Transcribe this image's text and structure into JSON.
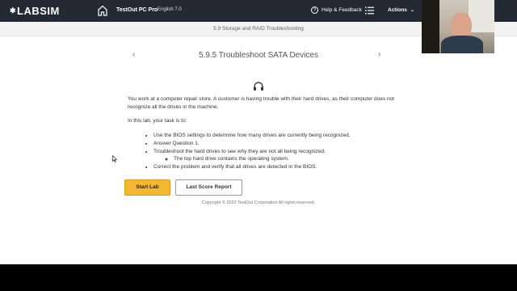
{
  "topbar": {
    "logo_text": "LABSIM",
    "logo_star": "✱",
    "product_name": "TestOut PC Pro",
    "language_version": "English 7.0",
    "help_label": "Help & Feedback",
    "help_glyph": "?",
    "actions_label": "Actions",
    "actions_chevron": "⌄"
  },
  "breadcrumb": {
    "section": "5.9 Storage and RAID Troubleshooting"
  },
  "lesson": {
    "prev_glyph": "‹",
    "next_glyph": "›",
    "title": "5.9.5 Troubleshoot SATA Devices",
    "intro": "You work at a computer repair store. A customer is having trouble with their hard drives, as their computer does not recognize all the drives in the machine.",
    "task_lead": "In this lab, your task is to:",
    "tasks": [
      "Use the BIOS settings to determine how many drives are currently being recognized.",
      "Answer Question 1.",
      "Troubleshoot the hard drives to see why they are not all being recognized.",
      "Correct the problem and verify that all drives are detected in the BIOS."
    ],
    "subtask": "The top hard drive contains the operating system."
  },
  "buttons": {
    "start_lab": "Start Lab",
    "last_score_report": "Last Score Report"
  },
  "footer": {
    "copyright": "Copyright © 2022 TestOut Corporation  All rights reserved."
  },
  "colors": {
    "topbar_bg": "#232a33",
    "start_button": "#f4b731"
  },
  "icons": {
    "home": "home-icon",
    "help": "help-icon",
    "menu": "list-menu-icon",
    "headset": "headset-icon"
  }
}
